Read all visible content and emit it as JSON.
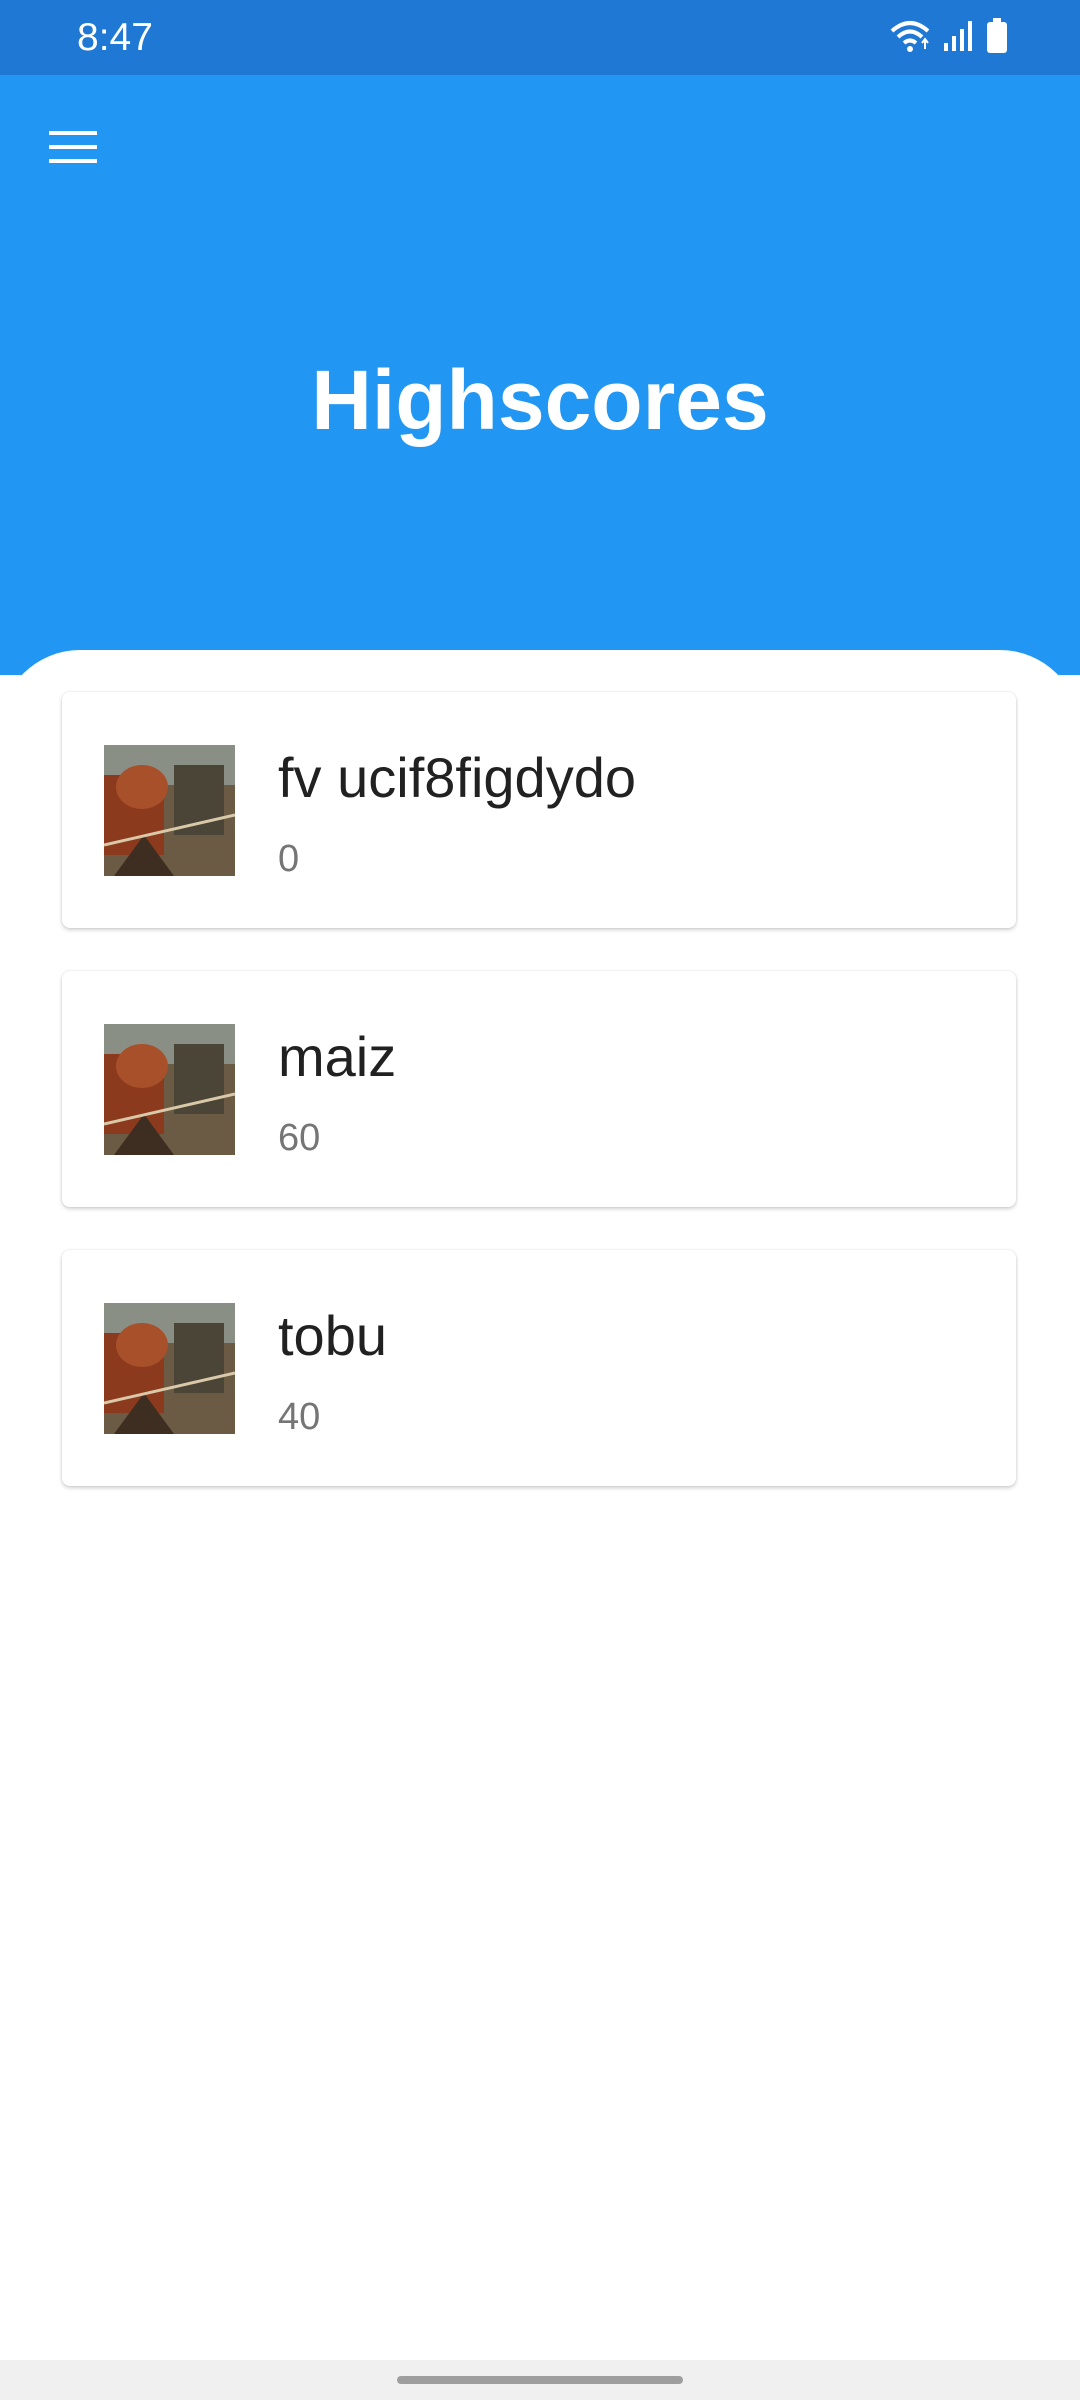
{
  "status_bar": {
    "time": "8:47",
    "icons": [
      "wifi-icon",
      "signal-icon",
      "battery-icon"
    ]
  },
  "header": {
    "menu_icon": "hamburger-menu-icon",
    "title": "Highscores",
    "background_color": "#2196f3"
  },
  "scores": [
    {
      "name": "fv ucif8figdydo",
      "score": "0",
      "avatar": "game-art-thumbnail"
    },
    {
      "name": "maiz",
      "score": "60",
      "avatar": "game-art-thumbnail"
    },
    {
      "name": "tobu",
      "score": "40",
      "avatar": "game-art-thumbnail"
    }
  ],
  "colors": {
    "status_bar": "#1e78d4",
    "header": "#2196f3",
    "name_text": "#212121",
    "score_text": "#757575"
  }
}
